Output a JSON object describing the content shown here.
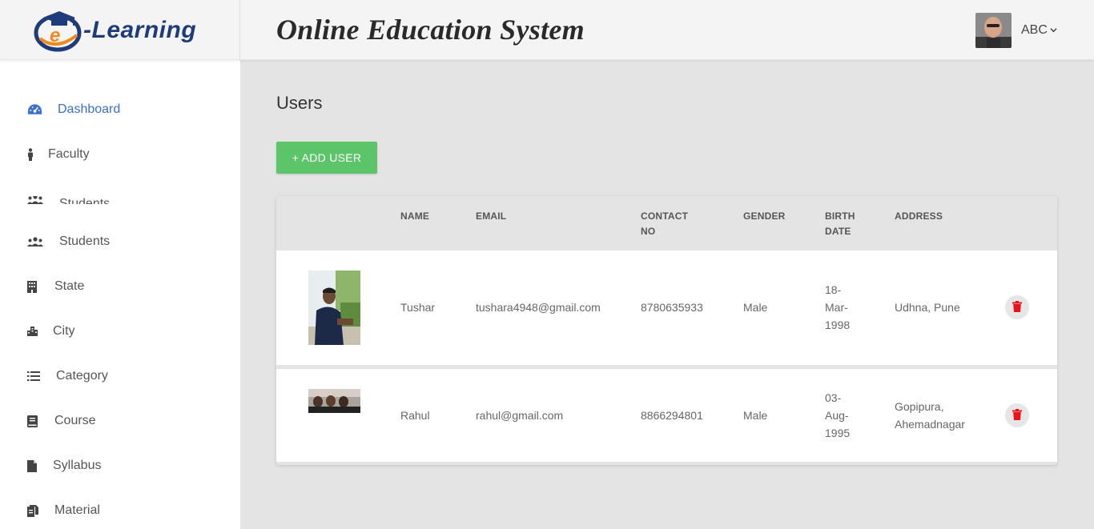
{
  "header": {
    "logo_text": "-Learning",
    "logo_letter": "e",
    "app_title": "Online Education System",
    "user_name": "ABC"
  },
  "sidebar": {
    "items": [
      {
        "label": "Dashboard",
        "icon": "dashboard-icon"
      },
      {
        "label": "Faculty",
        "icon": "person-icon"
      },
      {
        "label": "Students",
        "icon": "users-icon"
      },
      {
        "label": "Students",
        "icon": "users-icon"
      },
      {
        "label": "State",
        "icon": "building-icon"
      },
      {
        "label": "City",
        "icon": "city-icon"
      },
      {
        "label": "Category",
        "icon": "list-icon"
      },
      {
        "label": "Course",
        "icon": "book-icon"
      },
      {
        "label": "Syllabus",
        "icon": "file-icon"
      },
      {
        "label": "Material",
        "icon": "files-icon"
      }
    ]
  },
  "main": {
    "title": "Users",
    "add_button": "+ ADD USER",
    "columns": [
      "NAME",
      "EMAIL",
      "CONTACT NO",
      "GENDER",
      "BIRTH DATE",
      "ADDRESS"
    ],
    "rows": [
      {
        "name": "Tushar",
        "email": "tushara4948@gmail.com",
        "contact": "8780635933",
        "gender": "Male",
        "birth_date": "18-Mar-1998",
        "address": "Udhna, Pune"
      },
      {
        "name": "Rahul",
        "email": "rahul@gmail.com",
        "contact": "8866294801",
        "gender": "Male",
        "birth_date": "03-Aug-1995",
        "address": "Gopipura, Ahemadnagar"
      }
    ]
  },
  "colors": {
    "accent": "#3b6fd0",
    "add_button": "#5cc569",
    "delete_icon": "#e8141b",
    "logo_blue": "#1f3c7a",
    "logo_orange": "#f0891e"
  }
}
